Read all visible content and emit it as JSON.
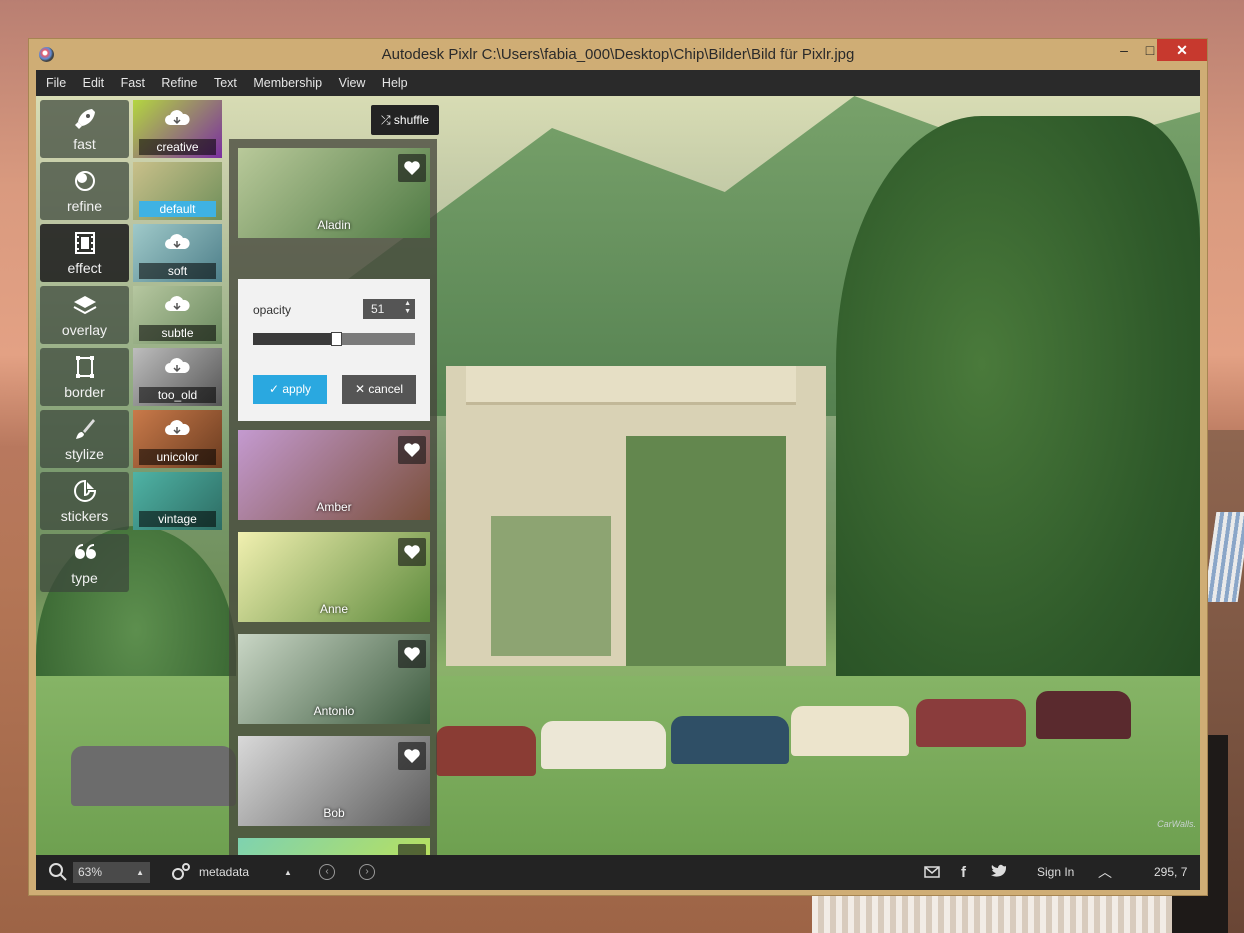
{
  "window": {
    "title": "Autodesk Pixlr   C:\\Users\\fabia_000\\Desktop\\Chip\\Bilder\\Bild für Pixlr.jpg",
    "minimize": "–",
    "maximize": "□",
    "close": "✕"
  },
  "menu": [
    "File",
    "Edit",
    "Fast",
    "Refine",
    "Text",
    "Membership",
    "View",
    "Help"
  ],
  "tools": [
    {
      "label": "fast",
      "icon": "rocket-icon"
    },
    {
      "label": "refine",
      "icon": "refine-icon"
    },
    {
      "label": "effect",
      "icon": "film-icon",
      "active": true
    },
    {
      "label": "overlay",
      "icon": "layers-icon"
    },
    {
      "label": "border",
      "icon": "border-icon"
    },
    {
      "label": "stylize",
      "icon": "brush-icon"
    },
    {
      "label": "stickers",
      "icon": "sticker-icon"
    },
    {
      "label": "type",
      "icon": "quote-icon"
    }
  ],
  "effect_categories": [
    {
      "label": "creative",
      "colors": [
        "#b4d640",
        "#7a2ea0"
      ]
    },
    {
      "label": "default",
      "colors": [
        "#c9c08a",
        "#6f8f5a"
      ],
      "selected": true
    },
    {
      "label": "soft",
      "colors": [
        "#9fc9c9",
        "#4e7f8a"
      ]
    },
    {
      "label": "subtle",
      "colors": [
        "#b6c7a0",
        "#6b8a5f"
      ]
    },
    {
      "label": "too_old",
      "colors": [
        "#bdbdbd",
        "#555555"
      ]
    },
    {
      "label": "unicolor",
      "colors": [
        "#c97a4a",
        "#6b3c20"
      ]
    },
    {
      "label": "vintage",
      "colors": [
        "#4fb3a5",
        "#2d6c63"
      ]
    }
  ],
  "shuffle_label": "shuffle",
  "effects": [
    {
      "name": "Aladin",
      "colors": [
        "#b9c99a",
        "#4f7a44"
      ]
    },
    {
      "name": "Amber",
      "colors": [
        "#c49ad0",
        "#7a4f3a"
      ]
    },
    {
      "name": "Anne",
      "colors": [
        "#f1f0b0",
        "#5d8a3c"
      ]
    },
    {
      "name": "Antonio",
      "colors": [
        "#c9d6c5",
        "#3c5a3e"
      ]
    },
    {
      "name": "Bob",
      "colors": [
        "#d9d9d9",
        "#5a5a5a"
      ]
    },
    {
      "name": "",
      "colors": [
        "#7ed2b0",
        "#b7e060"
      ]
    }
  ],
  "opacity": {
    "label": "opacity",
    "value": 51,
    "max": 100
  },
  "apply_label": "apply",
  "cancel_label": "cancel",
  "status": {
    "zoom": "63%",
    "metadata": "metadata",
    "sign_in": "Sign In",
    "coords": "295, 7"
  },
  "canvas_watermark": "CarWalls.",
  "colors": {
    "accent": "#2aa8e0",
    "close_button": "#c7392e",
    "window_frame": "#cfad75"
  }
}
